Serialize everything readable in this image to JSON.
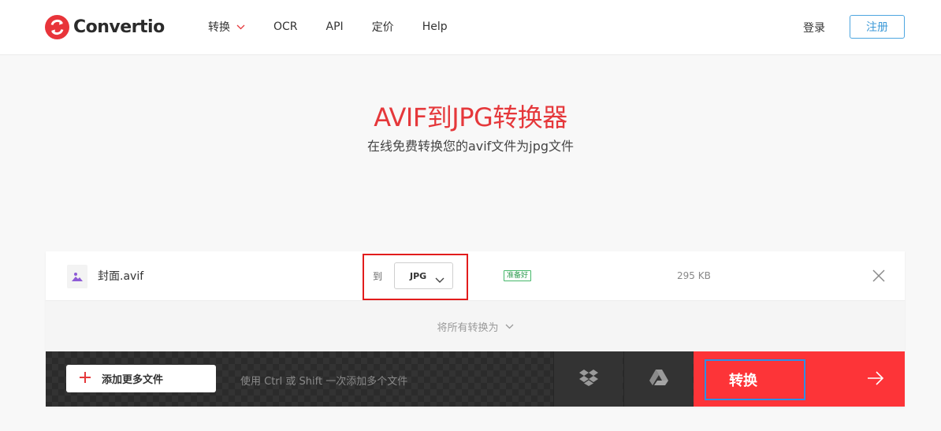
{
  "header": {
    "logo_text": "Convertio",
    "nav": [
      {
        "label": "转换",
        "has_dropdown": true
      },
      {
        "label": "OCR"
      },
      {
        "label": "API"
      },
      {
        "label": "定价"
      },
      {
        "label": "Help"
      }
    ],
    "login_label": "登录",
    "register_label": "注册"
  },
  "hero": {
    "title": "AVIF到JPG转换器",
    "subtitle": "在线免费转换您的avif文件为jpg文件"
  },
  "file": {
    "icon": "image-file-icon",
    "name": "封面.avif",
    "to_label": "到",
    "target_format": "JPG",
    "status": "准备好",
    "size": "295 KB"
  },
  "convert_all_label": "将所有转换为",
  "bottom_bar": {
    "add_more_label": "添加更多文件",
    "hint": "使用 Ctrl 或 Shift 一次添加多个文件",
    "cloud_icons": [
      "dropbox-icon",
      "google-drive-icon"
    ],
    "convert_label": "转换"
  },
  "colors": {
    "accent_red": "#fd3438",
    "title_red": "#e5383b",
    "register_blue": "#3d9ad8",
    "status_green": "#2d9a4f",
    "focus_blue": "#2e8ee6"
  }
}
